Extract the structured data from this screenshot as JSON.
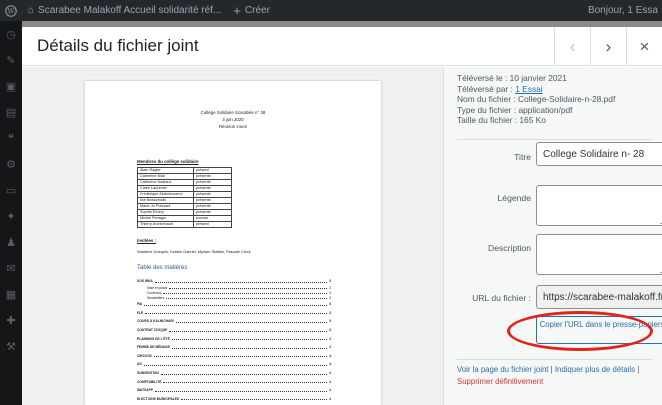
{
  "adminbar": {
    "site_name": "Scarabee Malakoff Accueil solidarité réf...",
    "new_label": "Créer",
    "greeting": "Bonjour, 1 Essa"
  },
  "modal": {
    "title": "Détails du fichier joint",
    "prev": "‹",
    "next": "›",
    "close": "×"
  },
  "document": {
    "header_line1": "Collège Solidaire Scarabée n° 28",
    "header_line2": "3 juin 2020",
    "header_line3": "Réunion zoom",
    "members_title": "Membres du collège solidaire",
    "members": [
      [
        "Alain Ragler",
        "présent"
      ],
      [
        "Catherine Bilal",
        "présente"
      ],
      [
        "Catherine Nastaux",
        "présente"
      ],
      [
        "Claire Laurentie",
        "présente"
      ],
      [
        "Frédérique Abdelmoumni",
        "présente"
      ],
      [
        "Ilse Beauchods",
        "présente"
      ],
      [
        "Marie-Jo Poissant",
        "présente"
      ],
      [
        "Sophie Emery",
        "présente"
      ],
      [
        "Michel Penager",
        "excusé"
      ],
      [
        "Thierry Archimbault",
        "présent"
      ]
    ],
    "invites_title": "Invitées :",
    "invites": "Sandrine Dosquin, Katalin Gabriel, Myriam Staffan, Pascale Clevy",
    "toc_title": "Table des matières",
    "toc": [
      {
        "label": "SOS WKA",
        "page": "3",
        "sub": false
      },
      {
        "label": "Mise en place",
        "page": "3",
        "sub": true
      },
      {
        "label": "Contenus",
        "page": "3",
        "sub": true
      },
      {
        "label": "Newsletters",
        "page": "3",
        "sub": true
      },
      {
        "label": "PAI",
        "page": "3",
        "sub": false
      },
      {
        "label": "FLE",
        "page": "3",
        "sub": false
      },
      {
        "label": "COURS À KALNICHARI",
        "page": "3",
        "sub": false
      },
      {
        "label": "CONTRAT CIVIQUE",
        "page": "3",
        "sub": false
      },
      {
        "label": "PLANNING DE L'ÉTÉ",
        "page": "3",
        "sub": false
      },
      {
        "label": "FEMME DE MÉNAGE",
        "page": "3",
        "sub": false
      },
      {
        "label": "CIRCUSX",
        "page": "4",
        "sub": false
      },
      {
        "label": "AG",
        "page": "4",
        "sub": false
      },
      {
        "label": "SUBVENTION",
        "page": "4",
        "sub": false
      },
      {
        "label": "COMPTABILITÉ",
        "page": "4",
        "sub": false
      },
      {
        "label": "WATSAPP",
        "page": "4",
        "sub": false
      },
      {
        "label": "ELECTIONS MUNICIPALES",
        "page": "4",
        "sub": false
      }
    ]
  },
  "meta": {
    "uploaded_on": "Téléversé le : 10 janvier 2021",
    "uploaded_by_prefix": "Téléversé par : ",
    "uploaded_by_link": "1 Essai",
    "file_name": "Nom du fichier : College-Solidaire-n-28.pdf",
    "file_type": "Type du fichier : application/pdf",
    "file_size": "Taille du fichier : 165 Ko"
  },
  "fields": {
    "title_label": "Titre",
    "title_value": "College Solidaire n- 28",
    "caption_label": "Légende",
    "caption_value": "",
    "description_label": "Description",
    "description_value": "",
    "url_label": "URL du fichier :",
    "url_value": "https://scarabee-malakoff.fr",
    "copy_button": "Copier l'URL dans le presse-papiers"
  },
  "links": {
    "view_page": "Voir la page du fichier joint",
    "separator": "|",
    "more_details": "Indiquer plus de détails",
    "delete": "Supprimer définitivement"
  }
}
